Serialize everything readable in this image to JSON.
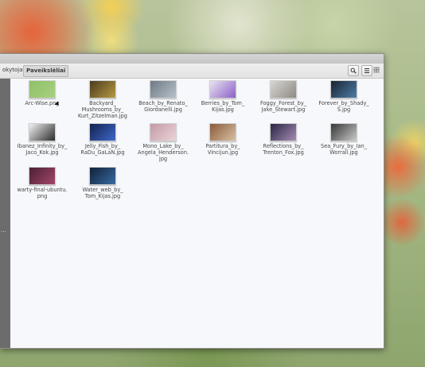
{
  "toolbar": {
    "prev_crumb": "okytoja",
    "active_crumb": "Paveikslėliai",
    "search_icon": "search-icon",
    "list_view_icon": "list-view-icon",
    "grid_view_icon": "grid-view-icon"
  },
  "files": [
    {
      "name": "Arc-Wise.png",
      "color": "#8fc06a",
      "color2": "#a8d07e"
    },
    {
      "name": "Backyard_\nMushrooms_by_\nKurt_Zitzelman.jpg",
      "color": "#4b3a1d",
      "color2": "#b59a44"
    },
    {
      "name": "Beach_by_Renato_\nGiordanelli.jpg",
      "color": "#6d7a86",
      "color2": "#b8c1c8"
    },
    {
      "name": "Berries_by_Tom_\nKijas.jpg",
      "color": "#e9e4f2",
      "color2": "#8b5fc7"
    },
    {
      "name": "Foggy_Forest_by_\nJake_Stewart.jpg",
      "color": "#d9d6d2",
      "color2": "#8d8983"
    },
    {
      "name": "Forever_by_Shady_\nS.jpg",
      "color": "#1b2330",
      "color2": "#4d7ea9"
    },
    {
      "name": "Ibanez_Infinity_by_\nJaco_Kok.jpg",
      "color": "#f2f2f2",
      "color2": "#2b2b2b"
    },
    {
      "name": "Jelly_Fish_by_\nRaDu_GaLaN.jpg",
      "color": "#13224e",
      "color2": "#3f67c9"
    },
    {
      "name": "Mono_Lake_by_\nAngela_Henderson.\njpg",
      "color": "#c49aa8",
      "color2": "#ead4d6"
    },
    {
      "name": "Partitura_by_\nVincijun.jpg",
      "color": "#8a5b3a",
      "color2": "#d8c0a4"
    },
    {
      "name": "Reflections_by_\nTrenton_Fox.jpg",
      "color": "#2a2540",
      "color2": "#a58cb6"
    },
    {
      "name": "Sea_Fury_by_Ian_\nWorrall.jpg",
      "color": "#363636",
      "color2": "#c9c9c9"
    },
    {
      "name": "warty-final-ubuntu.\npng",
      "color": "#4a1f35",
      "color2": "#a3476a"
    },
    {
      "name": "Water_web_by_\nTom_Kijas.jpg",
      "color": "#0f2138",
      "color2": "#3a6aa3"
    }
  ]
}
